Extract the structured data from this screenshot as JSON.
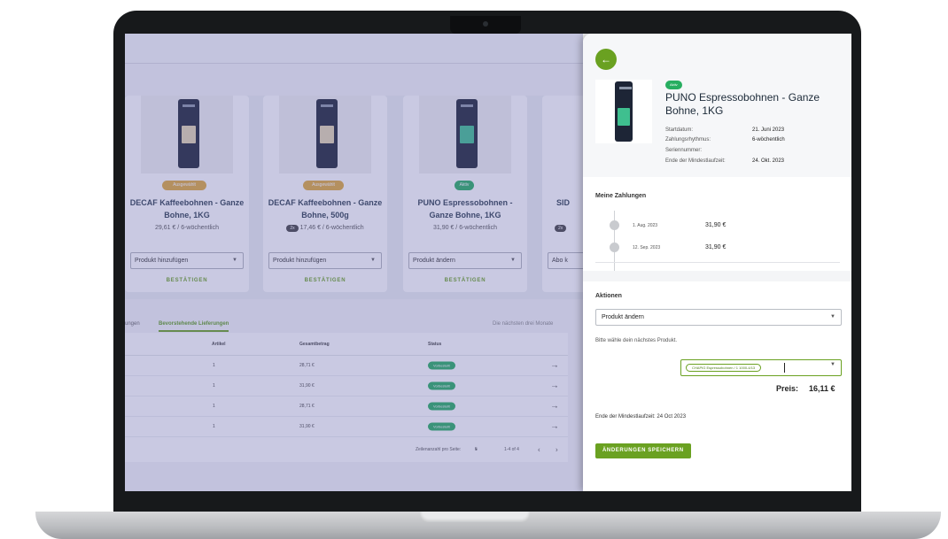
{
  "products": [
    {
      "badge": "Ausgewählt",
      "badge_color": "#e0a93a",
      "label_color": "#e4d6b0",
      "title_line1": "DECAF Kaffeebohnen - Ganze",
      "title_line2": "Bohne, 1KG",
      "price": "29,61 € / 6-wöchentlich",
      "select": "Produkt hinzufügen",
      "confirm": "BESTÄTIGEN"
    },
    {
      "badge": "Ausgewählt",
      "badge_color": "#e0a93a",
      "label_color": "#e4d6b0",
      "title_line1": "DECAF Kaffeebohnen - Ganze",
      "title_line2": "Bohne, 500g",
      "qty": "2x",
      "price": "17,46 € / 6-wöchentlich",
      "select": "Produkt hinzufügen",
      "confirm": "BESTÄTIGEN"
    },
    {
      "badge": "Aktiv",
      "badge_color": "#27ae60",
      "label_color": "#3fbf8f",
      "title_line1": "PUNO Espressobohnen -",
      "title_line2": "Ganze Bohne, 1KG",
      "price": "31,90 € / 6-wöchentlich",
      "select": "Produkt ändern",
      "confirm": "BESTÄTIGEN"
    }
  ],
  "partial_card": {
    "title": "SID",
    "qty": "2x",
    "select": "Abo k"
  },
  "tabs": {
    "first": "ungen",
    "active": "Bevorstehende Lieferungen",
    "right": "Die nächsten drei Monate"
  },
  "table": {
    "headers": {
      "article": "Artikel",
      "total": "Gesamtbetrag",
      "status": "Status"
    },
    "rows": [
      {
        "article": "1",
        "total": "28,71 €",
        "status": "Vorbestellt"
      },
      {
        "article": "1",
        "total": "31,90 €",
        "status": "Vorbestellt"
      },
      {
        "article": "1",
        "total": "28,71 €",
        "status": "Vorbestellt"
      },
      {
        "article": "1",
        "total": "31,90 €",
        "status": "Vorbestellt"
      }
    ],
    "pager": {
      "rows_label": "Zeilenanzahl pro Seite:",
      "rows_value": "5",
      "range": "1-4 of 4"
    }
  },
  "drawer": {
    "back_icon": "arrow-left-icon",
    "badge": "Aktiv",
    "title": "PUNO Espressobohnen - Ganze Bohne, 1KG",
    "meta": [
      {
        "label": "Startdatum:",
        "value": "21. Juni 2023"
      },
      {
        "label": "Zahlungsrhythmus:",
        "value": "6-wöchentlich"
      },
      {
        "label": "Seriennummer:",
        "value": ""
      },
      {
        "label": "Ende der Mindestlaufzeit:",
        "value": "24. Okt. 2023"
      }
    ],
    "payments_title": "Meine Zahlungen",
    "payments": [
      {
        "date": "1. Aug. 2023",
        "amount": "31,90 €"
      },
      {
        "date": "12. Sep. 2023",
        "amount": "31,90 €"
      }
    ],
    "actions_title": "Aktionen",
    "action_select": "Produkt ändern",
    "hint": "Bitte wähle dein nächstes Produkt.",
    "product_chip": "CHAPIG Espressobohnen / 1 1000-4/13",
    "price_label": "Preis:",
    "price_value": "16,11 €",
    "end_note": "Ende der Mindestlaufzeit: 24 Oct 2023",
    "save_button": "ÄNDERUNGEN SPEICHERN"
  },
  "colors": {
    "accent": "#6aa121",
    "active_green": "#27ae60",
    "selected_amber": "#e0a93a"
  }
}
